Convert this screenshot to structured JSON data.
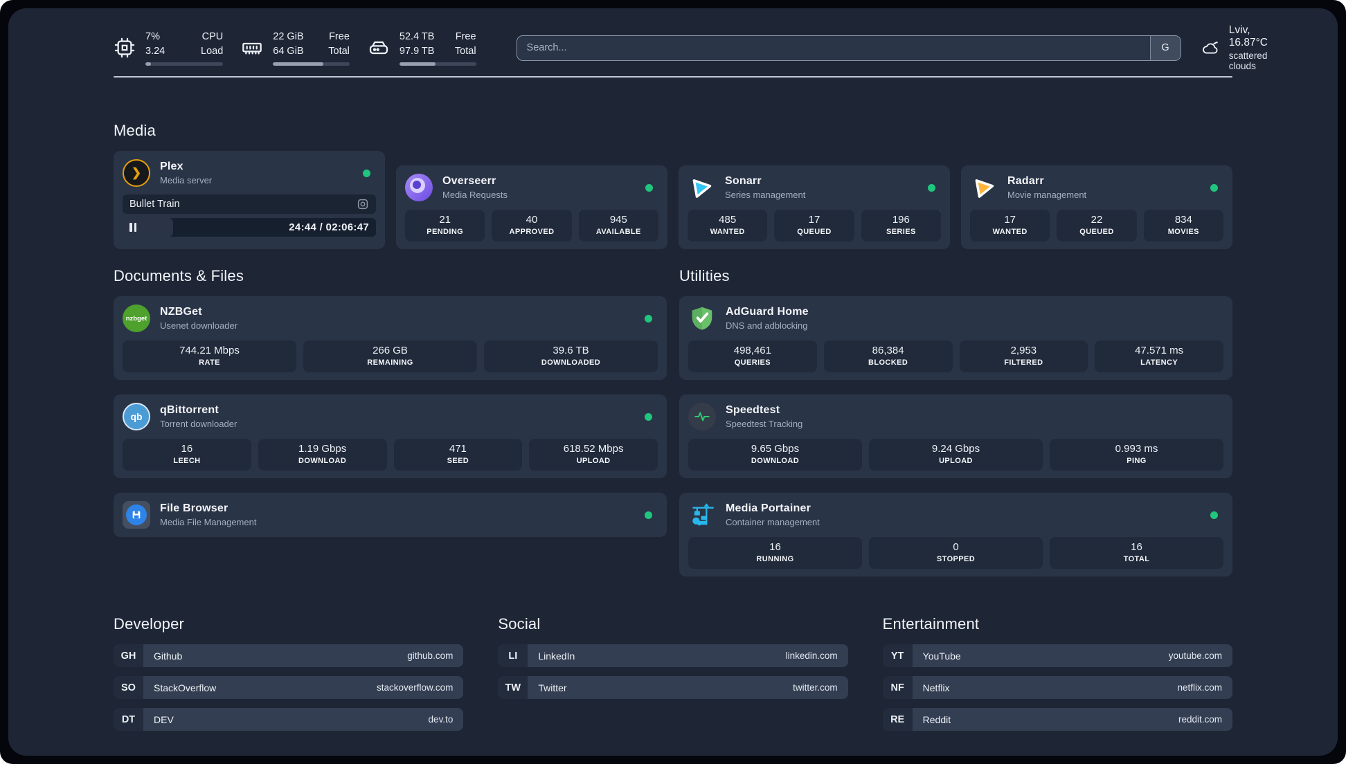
{
  "topbar": {
    "stats": [
      {
        "icon": "cpu",
        "value_top": "7%",
        "value_bottom": "3.24",
        "label_top": "CPU",
        "label_bottom": "Load",
        "progress": 7
      },
      {
        "icon": "ram",
        "value_top": "22 GiB",
        "value_bottom": "64 GiB",
        "label_top": "Free",
        "label_bottom": "Total",
        "progress": 66
      },
      {
        "icon": "disk",
        "value_top": "52.4 TB",
        "value_bottom": "97.9 TB",
        "label_top": "Free",
        "label_bottom": "Total",
        "progress": 47
      }
    ],
    "search": {
      "placeholder": "Search...",
      "button_label": "G"
    },
    "weather": {
      "title": "Lviv, 16.87°C",
      "subtitle": "scattered clouds"
    }
  },
  "media": {
    "title": "Media",
    "cards": [
      {
        "name": "Plex",
        "subtitle": "Media server",
        "status": "online",
        "now_playing": {
          "title": "Bullet Train",
          "time": "24:44 / 02:06:47",
          "progress": 20
        }
      },
      {
        "name": "Overseerr",
        "subtitle": "Media Requests",
        "status": "online",
        "stats": [
          {
            "value": "21",
            "label": "PENDING"
          },
          {
            "value": "40",
            "label": "APPROVED"
          },
          {
            "value": "945",
            "label": "AVAILABLE"
          }
        ]
      },
      {
        "name": "Sonarr",
        "subtitle": "Series management",
        "status": "online",
        "stats": [
          {
            "value": "485",
            "label": "WANTED"
          },
          {
            "value": "17",
            "label": "QUEUED"
          },
          {
            "value": "196",
            "label": "SERIES"
          }
        ]
      },
      {
        "name": "Radarr",
        "subtitle": "Movie management",
        "status": "online",
        "stats": [
          {
            "value": "17",
            "label": "WANTED"
          },
          {
            "value": "22",
            "label": "QUEUED"
          },
          {
            "value": "834",
            "label": "MOVIES"
          }
        ]
      }
    ]
  },
  "documents": {
    "title": "Documents & Files",
    "cards": [
      {
        "name": "NZBGet",
        "subtitle": "Usenet downloader",
        "status": "online",
        "icon_text": "nzbget",
        "stats": [
          {
            "value": "744.21 Mbps",
            "label": "RATE"
          },
          {
            "value": "266 GB",
            "label": "REMAINING"
          },
          {
            "value": "39.6 TB",
            "label": "DOWNLOADED"
          }
        ]
      },
      {
        "name": "qBittorrent",
        "subtitle": "Torrent downloader",
        "status": "online",
        "icon_text": "qb",
        "stats": [
          {
            "value": "16",
            "label": "LEECH"
          },
          {
            "value": "1.19 Gbps",
            "label": "DOWNLOAD"
          },
          {
            "value": "471",
            "label": "SEED"
          },
          {
            "value": "618.52 Mbps",
            "label": "UPLOAD"
          }
        ]
      },
      {
        "name": "File Browser",
        "subtitle": "Media File Management",
        "status": "online"
      }
    ]
  },
  "utilities": {
    "title": "Utilities",
    "cards": [
      {
        "name": "AdGuard Home",
        "subtitle": "DNS and adblocking",
        "stats": [
          {
            "value": "498,461",
            "label": "QUERIES"
          },
          {
            "value": "86,384",
            "label": "BLOCKED"
          },
          {
            "value": "2,953",
            "label": "FILTERED"
          },
          {
            "value": "47.571 ms",
            "label": "LATENCY"
          }
        ]
      },
      {
        "name": "Speedtest",
        "subtitle": "Speedtest Tracking",
        "stats": [
          {
            "value": "9.65 Gbps",
            "label": "DOWNLOAD"
          },
          {
            "value": "9.24 Gbps",
            "label": "UPLOAD"
          },
          {
            "value": "0.993 ms",
            "label": "PING"
          }
        ]
      },
      {
        "name": "Media Portainer",
        "subtitle": "Container management",
        "status": "online",
        "stats": [
          {
            "value": "16",
            "label": "RUNNING"
          },
          {
            "value": "0",
            "label": "STOPPED"
          },
          {
            "value": "16",
            "label": "TOTAL"
          }
        ]
      }
    ]
  },
  "links": {
    "developer": {
      "title": "Developer",
      "items": [
        {
          "abbr": "GH",
          "name": "Github",
          "url": "github.com"
        },
        {
          "abbr": "SO",
          "name": "StackOverflow",
          "url": "stackoverflow.com"
        },
        {
          "abbr": "DT",
          "name": "DEV",
          "url": "dev.to"
        }
      ]
    },
    "social": {
      "title": "Social",
      "items": [
        {
          "abbr": "LI",
          "name": "LinkedIn",
          "url": "linkedin.com"
        },
        {
          "abbr": "TW",
          "name": "Twitter",
          "url": "twitter.com"
        }
      ]
    },
    "entertainment": {
      "title": "Entertainment",
      "items": [
        {
          "abbr": "YT",
          "name": "YouTube",
          "url": "youtube.com"
        },
        {
          "abbr": "NF",
          "name": "Netflix",
          "url": "netflix.com"
        },
        {
          "abbr": "RE",
          "name": "Reddit",
          "url": "reddit.com"
        }
      ]
    }
  },
  "colors": {
    "status_online": "#1fc77e",
    "accent_plex": "#e5a00d",
    "accent_sonarr": "#35c5f4",
    "accent_radarr": "#ffb53d",
    "accent_portainer": "#29b8eb"
  }
}
